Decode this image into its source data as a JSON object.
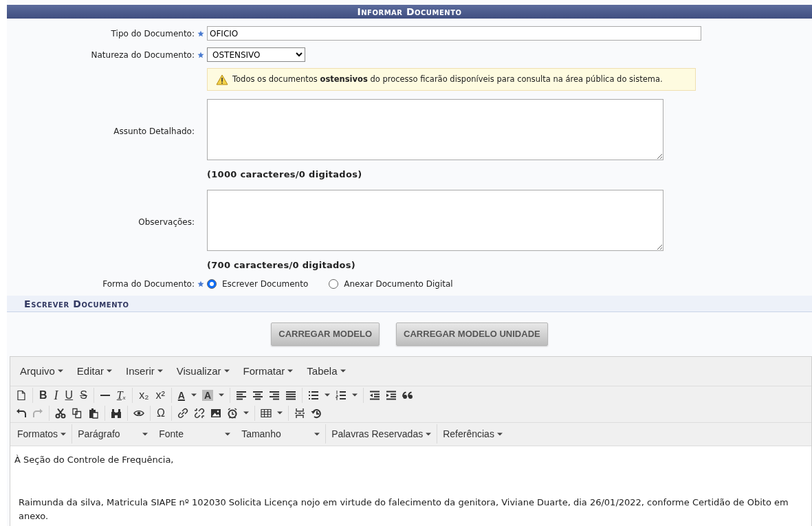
{
  "header": {
    "title": "Informar Documento"
  },
  "fields": [
    {
      "kind": "text",
      "label": "Tipo do Documento:",
      "required": true,
      "value": "OFICIO"
    },
    {
      "kind": "select",
      "label": "Natureza do Documento:",
      "required": true,
      "value": "OSTENSIVO"
    },
    {
      "kind": "notice",
      "text": "Todos os documentos **ostensivos** do processo ficarão disponíveis para consulta na área pública do sistema."
    },
    {
      "kind": "textarea",
      "label": "Assunto Detalhado:",
      "required": false,
      "counter": "(1000 caracteres/0 digitados)"
    },
    {
      "kind": "textarea",
      "label": "Observações:",
      "required": false,
      "counter": "(700 caracteres/0 digitados)"
    },
    {
      "kind": "radio",
      "label": "Forma do Documento:",
      "required": true,
      "options": [
        {
          "label": "Escrever Documento",
          "selected": true
        },
        {
          "label": "Anexar Documento Digital",
          "selected": false
        }
      ]
    }
  ],
  "section": {
    "title": "Escrever Documento"
  },
  "buttons": [
    "CARREGAR MODELO",
    "CARREGAR MODELO UNIDADE"
  ],
  "editor": {
    "menus": [
      "Arquivo",
      "Editar",
      "Inserir",
      "Visualizar",
      "Formatar",
      "Tabela"
    ],
    "toolbar_rows": [
      [
        [
          {
            "kind": "document",
            "disabled": false
          }
        ],
        [
          {
            "kind": "bold",
            "text": "B",
            "disabled": false
          },
          {
            "kind": "italic",
            "text": "I",
            "disabled": false
          },
          {
            "kind": "underline",
            "text": "U",
            "disabled": false
          },
          {
            "kind": "strike",
            "text": "S",
            "disabled": false
          }
        ],
        [
          {
            "kind": "hr",
            "disabled": false
          },
          {
            "kind": "clear",
            "text": "Tₓ",
            "disabled": false
          }
        ],
        [
          {
            "kind": "plain",
            "text": "x₂",
            "disabled": false
          },
          {
            "kind": "plain",
            "text": "x²",
            "disabled": false
          }
        ],
        [
          {
            "kind": "fontcolor",
            "text": "A",
            "disabled": false
          },
          {
            "kind": "caret",
            "disabled": false
          },
          {
            "kind": "highlight",
            "text": "A",
            "disabled": false
          },
          {
            "kind": "caret",
            "disabled": false
          }
        ],
        [
          {
            "kind": "align-left",
            "disabled": false
          },
          {
            "kind": "align-center",
            "disabled": false
          },
          {
            "kind": "align-right",
            "disabled": false
          },
          {
            "kind": "justify",
            "disabled": false
          }
        ],
        [
          {
            "kind": "bullet-list",
            "disabled": false
          },
          {
            "kind": "caret",
            "disabled": false
          },
          {
            "kind": "numbered-list",
            "disabled": false
          },
          {
            "kind": "caret",
            "disabled": false
          }
        ],
        [
          {
            "kind": "outdent",
            "disabled": false
          },
          {
            "kind": "indent",
            "disabled": false
          },
          {
            "kind": "quote",
            "disabled": false
          }
        ]
      ],
      [
        [
          {
            "kind": "undo",
            "disabled": false
          },
          {
            "kind": "redo",
            "disabled": true
          }
        ],
        [
          {
            "kind": "cut",
            "disabled": false
          },
          {
            "kind": "copy",
            "disabled": false
          },
          {
            "kind": "paste",
            "disabled": false
          }
        ],
        [
          {
            "kind": "binoculars",
            "disabled": false
          }
        ],
        [
          {
            "kind": "eye",
            "disabled": false
          }
        ],
        [
          {
            "kind": "plain",
            "text": "Ω",
            "disabled": false
          }
        ],
        [
          {
            "kind": "link",
            "disabled": false
          },
          {
            "kind": "unlink",
            "disabled": false
          },
          {
            "kind": "image",
            "disabled": false
          },
          {
            "kind": "clock",
            "disabled": false
          },
          {
            "kind": "caret",
            "disabled": false
          }
        ],
        [
          {
            "kind": "table",
            "disabled": false
          },
          {
            "kind": "caret",
            "disabled": false
          }
        ],
        [
          {
            "kind": "pagebreak",
            "disabled": false
          },
          {
            "kind": "restore",
            "disabled": false
          }
        ]
      ]
    ],
    "format_menus": [
      {
        "label": "Formatos",
        "kind": "menu"
      },
      {
        "label": "Parágrafo",
        "kind": "combo"
      },
      {
        "label": "Fonte",
        "kind": "combo"
      },
      {
        "label": "Tamanho",
        "kind": "combo"
      },
      {
        "label": "Palavras Reservadas",
        "kind": "menu"
      },
      {
        "label": "Referências",
        "kind": "menu"
      }
    ],
    "content": [
      "À Seção do Controle de Frequência,",
      "Raimunda da silva, Matricula SIAPE nº 102030 Solicita Licença nojo em virtude do falecimento da genitora, Viviane Duarte, dia 26/01/2022, conforme Certidão de Obito em anexo."
    ]
  }
}
